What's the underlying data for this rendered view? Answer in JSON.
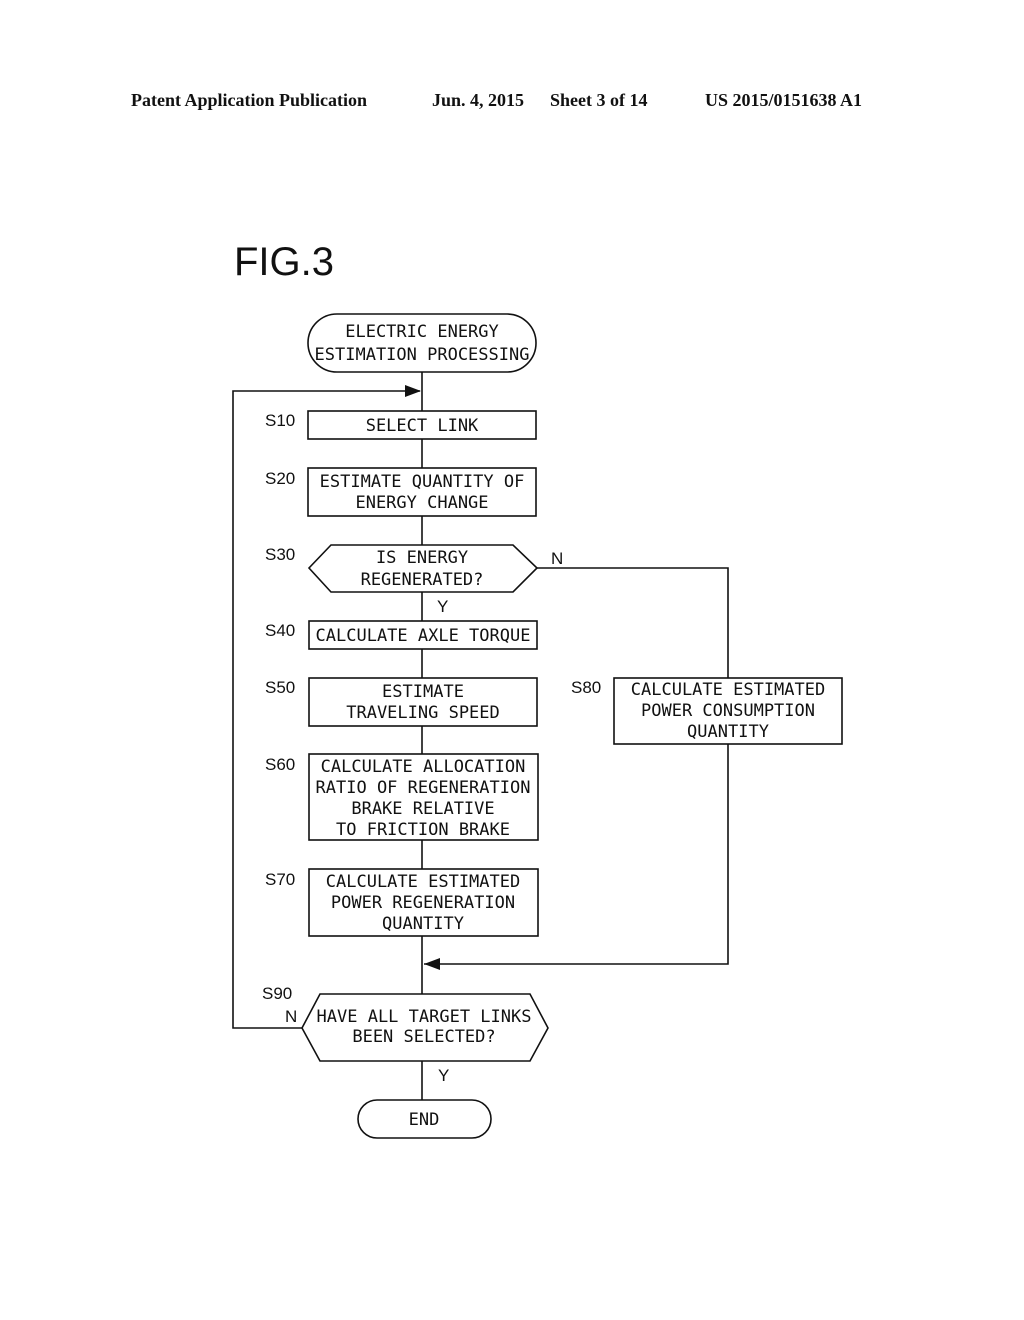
{
  "header": {
    "publication": "Patent Application Publication",
    "date": "Jun. 4, 2015",
    "sheet": "Sheet 3 of 14",
    "number": "US 2015/0151638 A1"
  },
  "figure": {
    "title": "FIG.3"
  },
  "flowchart": {
    "start": {
      "lines": [
        "ELECTRIC ENERGY",
        "ESTIMATION PROCESSING"
      ]
    },
    "steps": {
      "s10": {
        "label": "S10",
        "lines": [
          "SELECT LINK"
        ]
      },
      "s20": {
        "label": "S20",
        "lines": [
          "ESTIMATE QUANTITY OF",
          "ENERGY CHANGE"
        ]
      },
      "s30": {
        "label": "S30",
        "lines": [
          "IS ENERGY",
          "REGENERATED?"
        ],
        "yes": "Y",
        "no": "N"
      },
      "s40": {
        "label": "S40",
        "lines": [
          "CALCULATE AXLE TORQUE"
        ]
      },
      "s50": {
        "label": "S50",
        "lines": [
          "ESTIMATE",
          "TRAVELING SPEED"
        ]
      },
      "s60": {
        "label": "S60",
        "lines": [
          "CALCULATE ALLOCATION",
          "RATIO OF REGENERATION",
          "BRAKE RELATIVE",
          "TO FRICTION BRAKE"
        ]
      },
      "s70": {
        "label": "S70",
        "lines": [
          "CALCULATE ESTIMATED",
          "POWER REGENERATION",
          "QUANTITY"
        ]
      },
      "s80": {
        "label": "S80",
        "lines": [
          "CALCULATE ESTIMATED",
          "POWER CONSUMPTION",
          "QUANTITY"
        ]
      },
      "s90": {
        "label": "S90",
        "lines": [
          "HAVE ALL TARGET LINKS",
          "BEEN SELECTED?"
        ],
        "yes": "Y",
        "no": "N"
      }
    },
    "end": {
      "lines": [
        "END"
      ]
    }
  }
}
